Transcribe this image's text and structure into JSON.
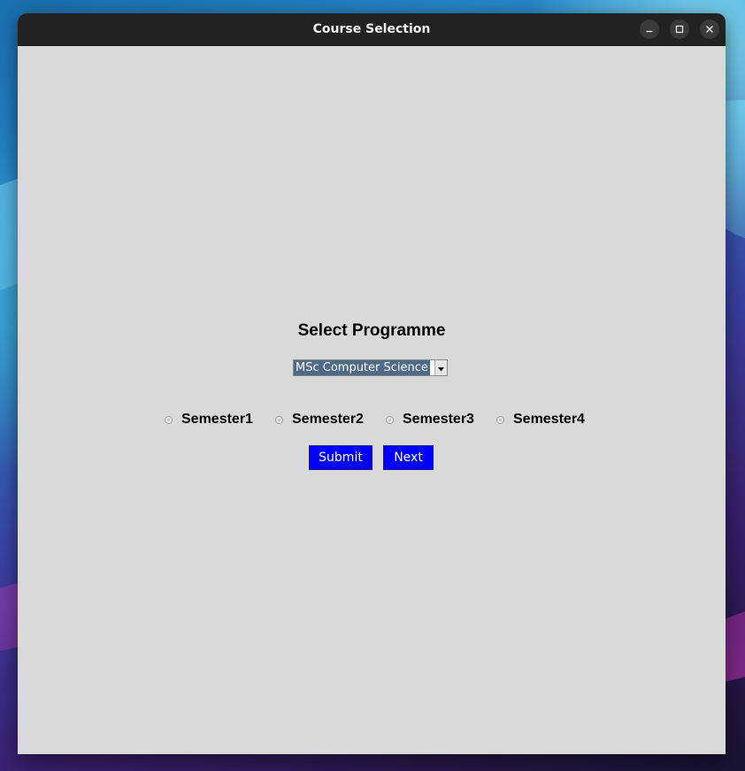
{
  "window": {
    "title": "Course Selection"
  },
  "main": {
    "heading": "Select Programme",
    "programme_select": {
      "value": "MSc Computer Science"
    },
    "semesters": [
      {
        "label": "Semester1",
        "selected": false
      },
      {
        "label": "Semester2",
        "selected": false
      },
      {
        "label": "Semester3",
        "selected": false
      },
      {
        "label": "Semester4",
        "selected": false
      }
    ],
    "buttons": {
      "submit": "Submit",
      "next": "Next"
    }
  },
  "colors": {
    "window_background": "#d9d9d9",
    "titlebar": "#222222",
    "button_background": "#0000ff",
    "button_text": "#ffffff",
    "select_highlight": "#4f6a86"
  },
  "icons": {
    "minimize": "minimize-icon",
    "maximize": "maximize-icon",
    "close": "close-icon",
    "dropdown": "chevron-down-icon"
  }
}
